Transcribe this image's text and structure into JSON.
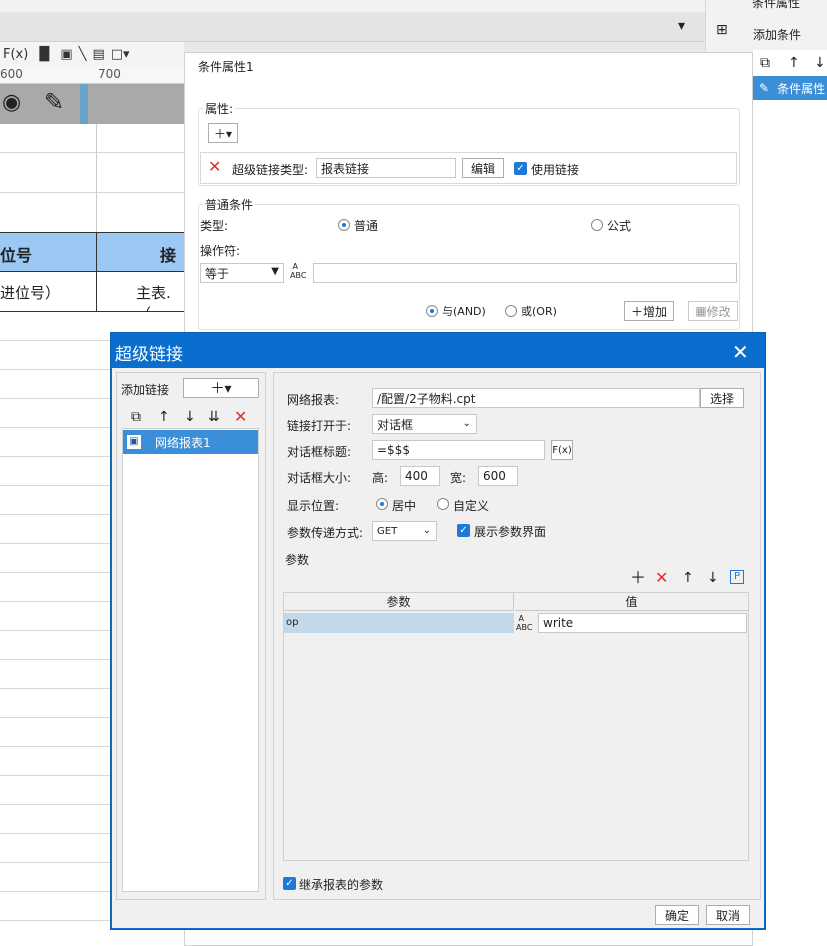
{
  "toolbar": {
    "fx": "F(x)",
    "ruler_600": "600",
    "ruler_700": "700"
  },
  "sheet": {
    "header_left": "位号",
    "header_right": "接收",
    "row1_left": "进位号）",
    "row1_right": "主表.（"
  },
  "right_panel": {
    "title": "条件属性",
    "add_condition": "添加条件",
    "selected_item": "条件属性"
  },
  "condition_panel": {
    "title": "条件属性1",
    "attr_section": "属性:",
    "link_type_label": "超级链接类型:",
    "link_type_value": "报表链接",
    "edit_button": "编辑",
    "use_link_label": "使用链接",
    "normal_section": "普通条件",
    "type_label": "类型:",
    "type_normal": "普通",
    "type_formula": "公式",
    "operator_label": "操作符:",
    "operator_value": "等于",
    "and_label": "与(AND)",
    "or_label": "或(OR)",
    "add_button": "增加",
    "modify_button": "修改"
  },
  "dialog": {
    "title": "超级链接",
    "add_link_label": "添加链接",
    "link_item": "网络报表1",
    "net_report_label": "网络报表:",
    "net_report_value": "/配置/2子物料.cpt",
    "select_button": "选择",
    "open_in_label": "链接打开于:",
    "open_in_value": "对话框",
    "dialog_title_label": "对话框标题:",
    "dialog_title_value": "=$$$",
    "fx_button": "F(x)",
    "dialog_size_label": "对话框大小:",
    "height_label": "高:",
    "height_value": "400",
    "width_label": "宽:",
    "width_value": "600",
    "position_label": "显示位置:",
    "position_center": "居中",
    "position_custom": "自定义",
    "param_method_label": "参数传递方式:",
    "param_method_value": "GET",
    "show_param_label": "展示参数界面",
    "params_section": "参数",
    "col_param": "参数",
    "col_value": "值",
    "param_rows": [
      {
        "name": "op",
        "value": "write"
      }
    ],
    "inherit_label": "继承报表的参数",
    "ok_button": "确定",
    "cancel_button": "取消"
  }
}
